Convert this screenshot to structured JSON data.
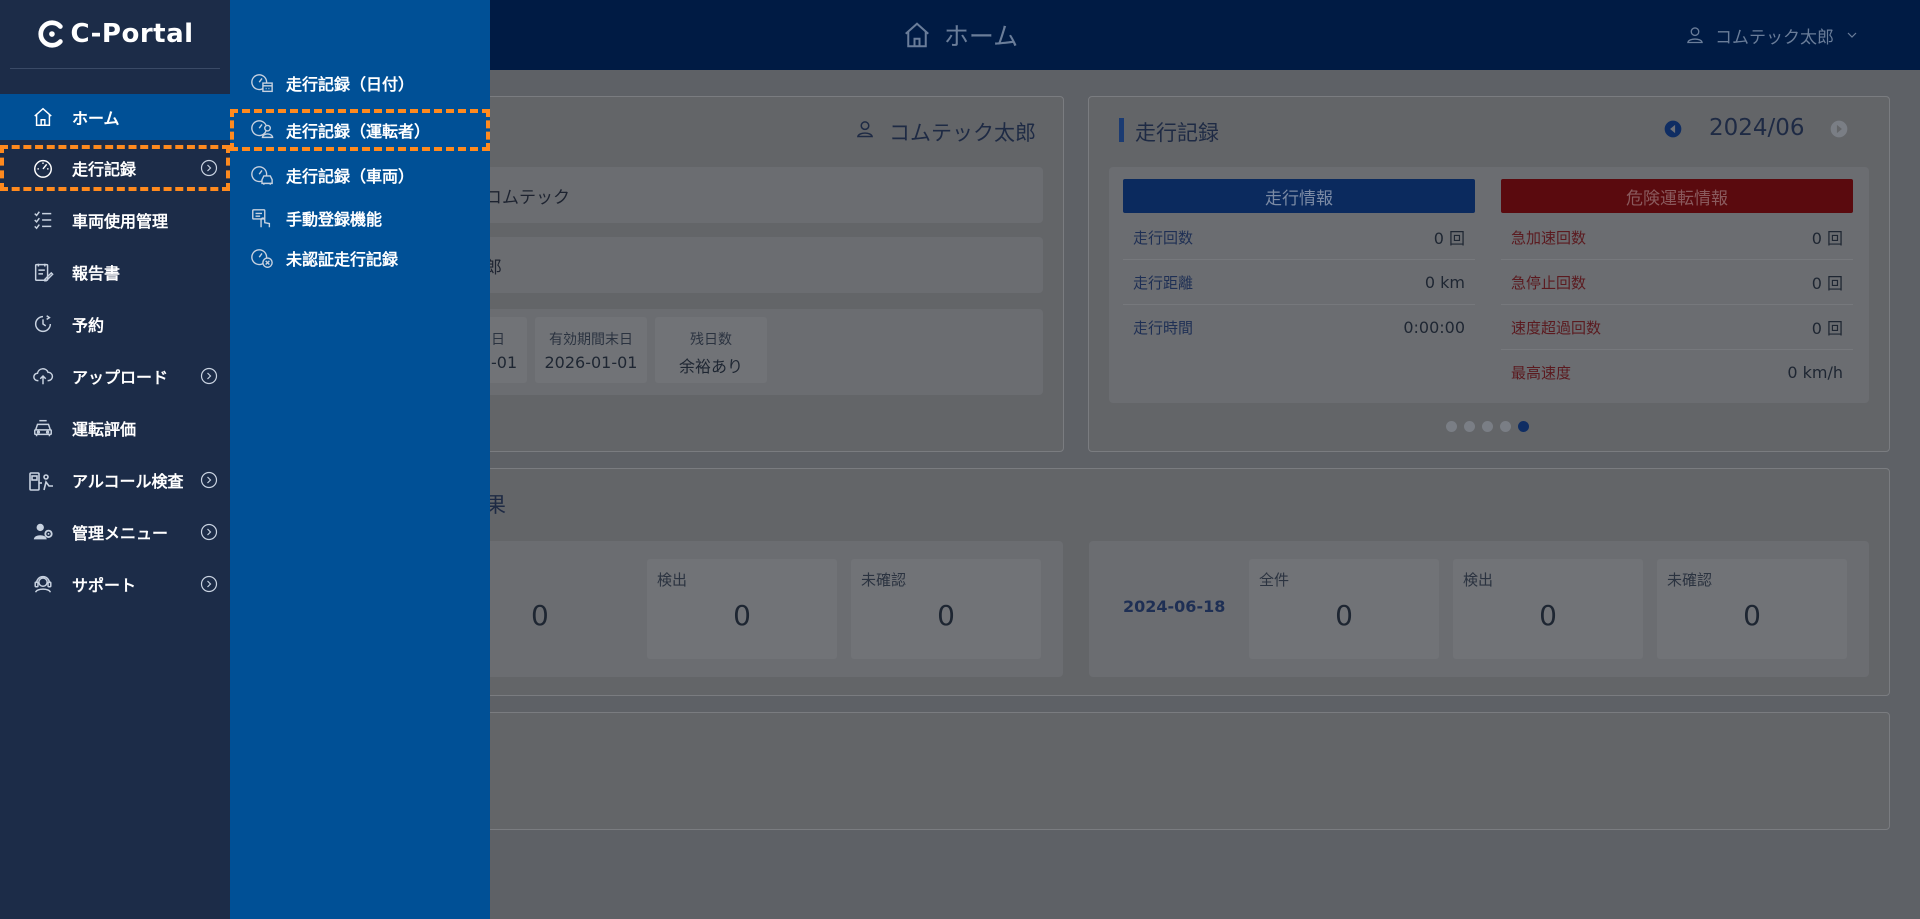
{
  "app": {
    "logo": "C-Portal"
  },
  "header": {
    "title": "ホーム",
    "user": "コムテック太郎"
  },
  "sidebar": {
    "items": [
      {
        "label": "ホーム",
        "icon": "home-icon",
        "has_sub": false
      },
      {
        "label": "走行記録",
        "icon": "speedometer-icon",
        "has_sub": true
      },
      {
        "label": "車両使用管理",
        "icon": "checklist-icon",
        "has_sub": false
      },
      {
        "label": "報告書",
        "icon": "report-icon",
        "has_sub": false
      },
      {
        "label": "予約",
        "icon": "clock-icon",
        "has_sub": false
      },
      {
        "label": "アップロード",
        "icon": "cloud-upload-icon",
        "has_sub": true
      },
      {
        "label": "運転評価",
        "icon": "car-front-icon",
        "has_sub": false
      },
      {
        "label": "アルコール検査",
        "icon": "breathalyzer-icon",
        "has_sub": true
      },
      {
        "label": "管理メニュー",
        "icon": "admin-gear-icon",
        "has_sub": true
      },
      {
        "label": "サポート",
        "icon": "support-agent-icon",
        "has_sub": true
      }
    ]
  },
  "submenu": {
    "items": [
      {
        "label": "走行記録（日付）",
        "icon": "speedometer-calendar-icon"
      },
      {
        "label": "走行記録（運転者）",
        "icon": "speedometer-driver-icon"
      },
      {
        "label": "走行記録（車両）",
        "icon": "speedometer-car-icon"
      },
      {
        "label": "手動登録機能",
        "icon": "manual-entry-icon"
      },
      {
        "label": "未認証走行記録",
        "icon": "speedometer-unverified-icon"
      }
    ]
  },
  "profile_card": {
    "user": "コムテック太郎",
    "company_partial": "コムテック",
    "name_partial": "郎",
    "date_label_partial": "日",
    "date_value_partial": "-01",
    "expiry_label": "有効期間末日",
    "expiry_value": "2026-01-01",
    "remaining_label": "残日数",
    "remaining_value": "余裕あり"
  },
  "drive_card": {
    "title": "走行記録",
    "month": "2024/06",
    "info_header": "走行情報",
    "danger_header": "危険運転情報",
    "info_rows": [
      {
        "label": "走行回数",
        "value": "0 回"
      },
      {
        "label": "走行距離",
        "value": "0 km"
      },
      {
        "label": "走行時間",
        "value": "0:00:00"
      }
    ],
    "danger_rows": [
      {
        "label": "急加速回数",
        "value": "0 回"
      },
      {
        "label": "急停止回数",
        "value": "0 回"
      },
      {
        "label": "速度超過回数",
        "value": "0 回"
      },
      {
        "label": "最高速度",
        "value": "0 km/h"
      }
    ]
  },
  "result_card": {
    "title_partial": "果",
    "left": {
      "all_value": "0",
      "detect_label": "検出",
      "detect_value": "0",
      "unconfirmed_label": "未確認",
      "unconfirmed_value": "0"
    },
    "right": {
      "date": "2024-06-18",
      "all_label": "全件",
      "all_value": "0",
      "detect_label": "検出",
      "detect_value": "0",
      "unconfirmed_label": "未確認",
      "unconfirmed_value": "0"
    }
  },
  "colors": {
    "sidebar": "#1c2c48",
    "submenu": "#005096",
    "highlight": "#ff8a1e"
  }
}
